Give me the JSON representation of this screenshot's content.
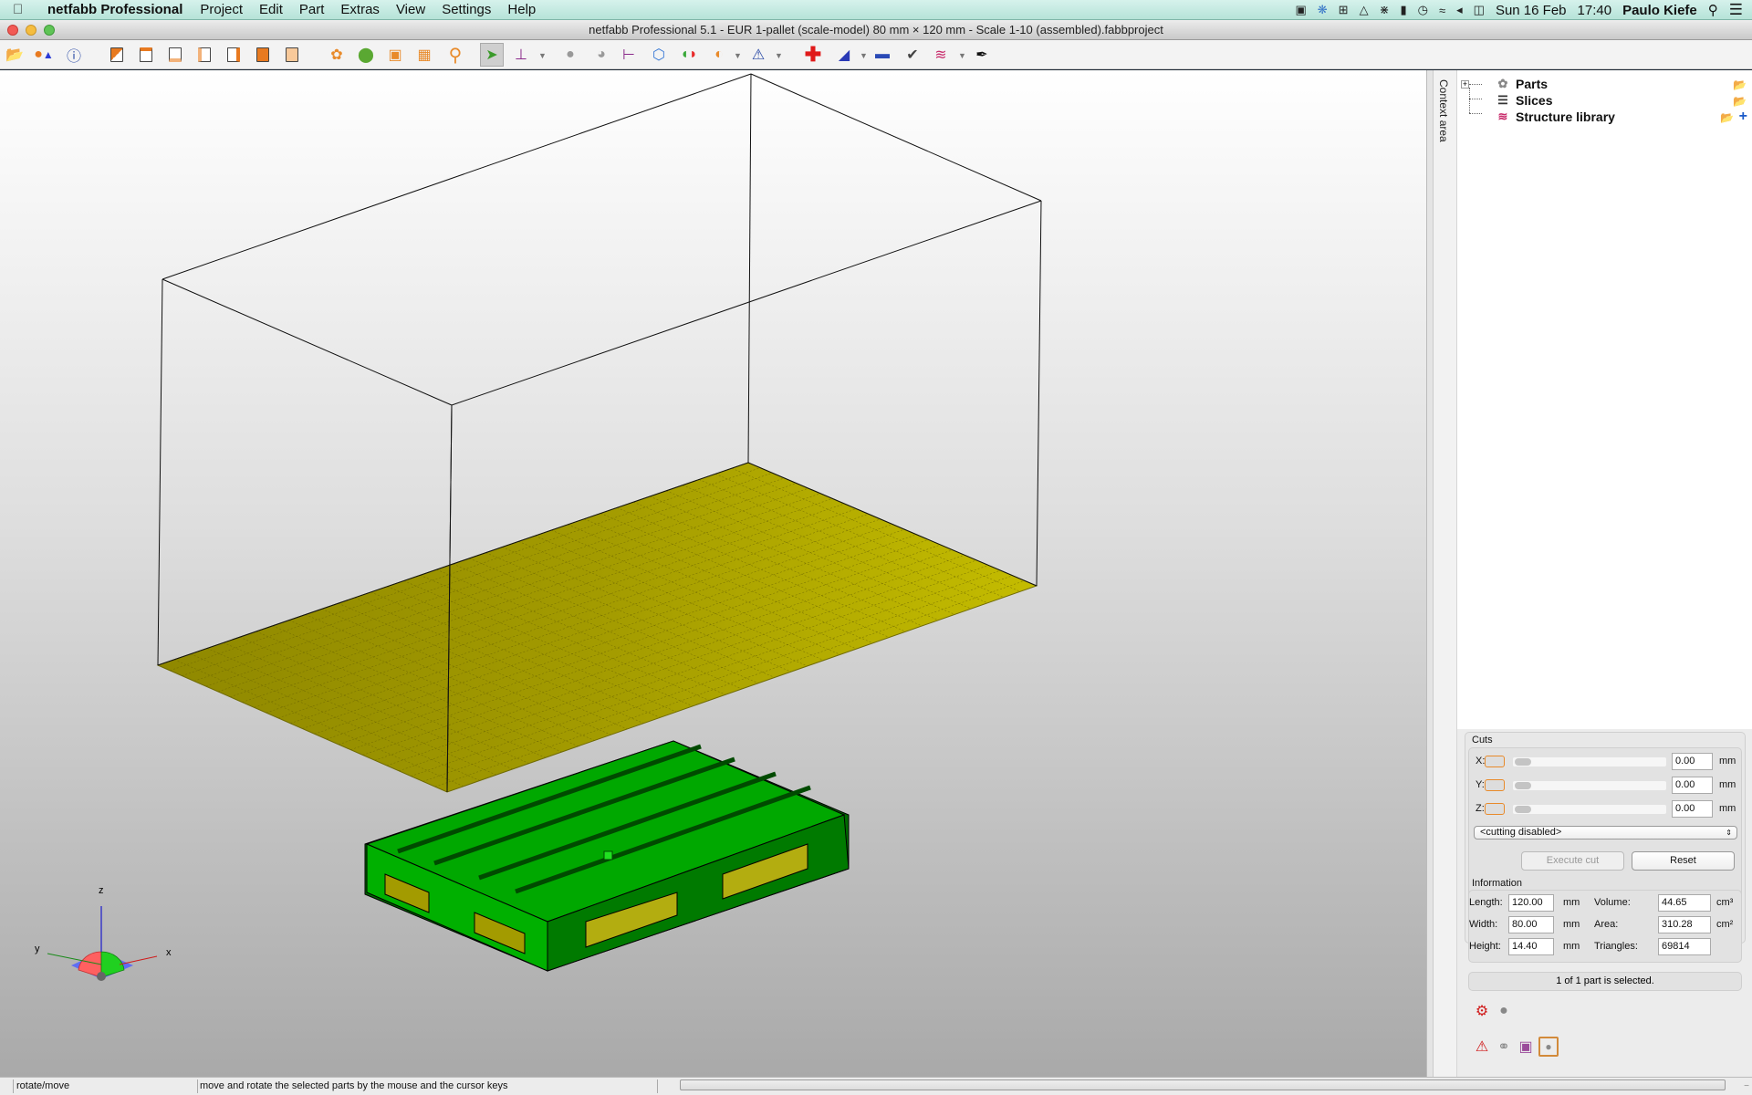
{
  "menubar": {
    "app_name": "netfabb Professional",
    "items": [
      "Project",
      "Edit",
      "Part",
      "Extras",
      "View",
      "Settings",
      "Help"
    ],
    "status_icons": [
      "sync-icon",
      "dropbox-icon",
      "download-icon",
      "airplay-icon",
      "bluetooth-icon",
      "battery-icon",
      "time-machine-icon",
      "wifi-icon",
      "volume-icon",
      "display-icon"
    ],
    "date": "Sun 16 Feb",
    "time": "17:40",
    "user": "Paulo Kiefe"
  },
  "window": {
    "title": "netfabb Professional 5.1 - EUR 1-pallet (scale-model) 80 mm × 120 mm - Scale 1-10 (assembled).fabbproject"
  },
  "toolbar": {
    "buttons": [
      "open-project",
      "add-part",
      "part-info",
      "view-iso",
      "view-top",
      "view-front",
      "view-left",
      "view-right",
      "view-back",
      "view-bottom",
      "select-all-parts",
      "select-part",
      "zoom-to-parts",
      "zoom-to-selection",
      "zoom",
      "select-mode",
      "move-rotate",
      "move",
      "rotate",
      "align",
      "scale-box",
      "split-view",
      "cut-sphere",
      "repair",
      "add",
      "shell",
      "measure",
      "check",
      "structure",
      "pen"
    ],
    "active": "select-mode"
  },
  "side_tab": {
    "label": "Context area"
  },
  "tree": {
    "items": [
      {
        "label": "Parts",
        "icon": "parts-icon",
        "expander": "+"
      },
      {
        "label": "Slices",
        "icon": "slices-icon"
      },
      {
        "label": "Structure library",
        "icon": "structure-icon"
      }
    ]
  },
  "cuts": {
    "title": "Cuts",
    "axes": [
      {
        "label": "X:",
        "value": "0.00",
        "unit": "mm"
      },
      {
        "label": "Y:",
        "value": "0.00",
        "unit": "mm"
      },
      {
        "label": "Z:",
        "value": "0.00",
        "unit": "mm"
      }
    ],
    "mode": "<cutting disabled>",
    "execute_label": "Execute cut",
    "reset_label": "Reset"
  },
  "information": {
    "title": "Information",
    "length": {
      "label": "Length:",
      "value": "120.00",
      "unit": "mm"
    },
    "width": {
      "label": "Width:",
      "value": "80.00",
      "unit": "mm"
    },
    "height": {
      "label": "Height:",
      "value": "14.40",
      "unit": "mm"
    },
    "volume": {
      "label": "Volume:",
      "value": "44.65",
      "unit": "cm³"
    },
    "area": {
      "label": "Area:",
      "value": "310.28",
      "unit": "cm²"
    },
    "triangles": {
      "label": "Triangles:",
      "value": "69814"
    }
  },
  "selection_status": "1 of 1 part is selected.",
  "axis_labels": {
    "x": "x",
    "y": "y",
    "z": "z"
  },
  "statusbar": {
    "mode": "rotate/move",
    "hint": "move and rotate the selected parts by the mouse and the cursor keys"
  },
  "colors": {
    "platform": "#a8a000",
    "part": "#00a800",
    "part_dark": "#006a00",
    "accent": "#e88a2a"
  }
}
